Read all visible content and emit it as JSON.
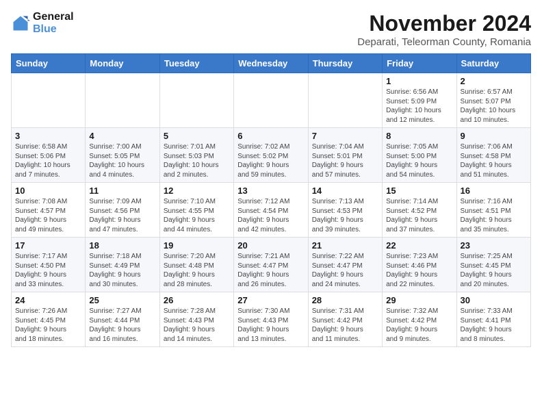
{
  "logo": {
    "line1": "General",
    "line2": "Blue"
  },
  "title": "November 2024",
  "subtitle": "Deparati, Teleorman County, Romania",
  "header": {
    "days": [
      "Sunday",
      "Monday",
      "Tuesday",
      "Wednesday",
      "Thursday",
      "Friday",
      "Saturday"
    ]
  },
  "weeks": [
    {
      "cells": [
        {
          "empty": true
        },
        {
          "empty": true
        },
        {
          "empty": true
        },
        {
          "empty": true
        },
        {
          "empty": true
        },
        {
          "day": 1,
          "info": "Sunrise: 6:56 AM\nSunset: 5:09 PM\nDaylight: 10 hours\nand 12 minutes."
        },
        {
          "day": 2,
          "info": "Sunrise: 6:57 AM\nSunset: 5:07 PM\nDaylight: 10 hours\nand 10 minutes."
        }
      ]
    },
    {
      "cells": [
        {
          "day": 3,
          "info": "Sunrise: 6:58 AM\nSunset: 5:06 PM\nDaylight: 10 hours\nand 7 minutes."
        },
        {
          "day": 4,
          "info": "Sunrise: 7:00 AM\nSunset: 5:05 PM\nDaylight: 10 hours\nand 4 minutes."
        },
        {
          "day": 5,
          "info": "Sunrise: 7:01 AM\nSunset: 5:03 PM\nDaylight: 10 hours\nand 2 minutes."
        },
        {
          "day": 6,
          "info": "Sunrise: 7:02 AM\nSunset: 5:02 PM\nDaylight: 9 hours\nand 59 minutes."
        },
        {
          "day": 7,
          "info": "Sunrise: 7:04 AM\nSunset: 5:01 PM\nDaylight: 9 hours\nand 57 minutes."
        },
        {
          "day": 8,
          "info": "Sunrise: 7:05 AM\nSunset: 5:00 PM\nDaylight: 9 hours\nand 54 minutes."
        },
        {
          "day": 9,
          "info": "Sunrise: 7:06 AM\nSunset: 4:58 PM\nDaylight: 9 hours\nand 51 minutes."
        }
      ]
    },
    {
      "cells": [
        {
          "day": 10,
          "info": "Sunrise: 7:08 AM\nSunset: 4:57 PM\nDaylight: 9 hours\nand 49 minutes."
        },
        {
          "day": 11,
          "info": "Sunrise: 7:09 AM\nSunset: 4:56 PM\nDaylight: 9 hours\nand 47 minutes."
        },
        {
          "day": 12,
          "info": "Sunrise: 7:10 AM\nSunset: 4:55 PM\nDaylight: 9 hours\nand 44 minutes."
        },
        {
          "day": 13,
          "info": "Sunrise: 7:12 AM\nSunset: 4:54 PM\nDaylight: 9 hours\nand 42 minutes."
        },
        {
          "day": 14,
          "info": "Sunrise: 7:13 AM\nSunset: 4:53 PM\nDaylight: 9 hours\nand 39 minutes."
        },
        {
          "day": 15,
          "info": "Sunrise: 7:14 AM\nSunset: 4:52 PM\nDaylight: 9 hours\nand 37 minutes."
        },
        {
          "day": 16,
          "info": "Sunrise: 7:16 AM\nSunset: 4:51 PM\nDaylight: 9 hours\nand 35 minutes."
        }
      ]
    },
    {
      "cells": [
        {
          "day": 17,
          "info": "Sunrise: 7:17 AM\nSunset: 4:50 PM\nDaylight: 9 hours\nand 33 minutes."
        },
        {
          "day": 18,
          "info": "Sunrise: 7:18 AM\nSunset: 4:49 PM\nDaylight: 9 hours\nand 30 minutes."
        },
        {
          "day": 19,
          "info": "Sunrise: 7:20 AM\nSunset: 4:48 PM\nDaylight: 9 hours\nand 28 minutes."
        },
        {
          "day": 20,
          "info": "Sunrise: 7:21 AM\nSunset: 4:47 PM\nDaylight: 9 hours\nand 26 minutes."
        },
        {
          "day": 21,
          "info": "Sunrise: 7:22 AM\nSunset: 4:47 PM\nDaylight: 9 hours\nand 24 minutes."
        },
        {
          "day": 22,
          "info": "Sunrise: 7:23 AM\nSunset: 4:46 PM\nDaylight: 9 hours\nand 22 minutes."
        },
        {
          "day": 23,
          "info": "Sunrise: 7:25 AM\nSunset: 4:45 PM\nDaylight: 9 hours\nand 20 minutes."
        }
      ]
    },
    {
      "cells": [
        {
          "day": 24,
          "info": "Sunrise: 7:26 AM\nSunset: 4:45 PM\nDaylight: 9 hours\nand 18 minutes."
        },
        {
          "day": 25,
          "info": "Sunrise: 7:27 AM\nSunset: 4:44 PM\nDaylight: 9 hours\nand 16 minutes."
        },
        {
          "day": 26,
          "info": "Sunrise: 7:28 AM\nSunset: 4:43 PM\nDaylight: 9 hours\nand 14 minutes."
        },
        {
          "day": 27,
          "info": "Sunrise: 7:30 AM\nSunset: 4:43 PM\nDaylight: 9 hours\nand 13 minutes."
        },
        {
          "day": 28,
          "info": "Sunrise: 7:31 AM\nSunset: 4:42 PM\nDaylight: 9 hours\nand 11 minutes."
        },
        {
          "day": 29,
          "info": "Sunrise: 7:32 AM\nSunset: 4:42 PM\nDaylight: 9 hours\nand 9 minutes."
        },
        {
          "day": 30,
          "info": "Sunrise: 7:33 AM\nSunset: 4:41 PM\nDaylight: 9 hours\nand 8 minutes."
        }
      ]
    }
  ]
}
